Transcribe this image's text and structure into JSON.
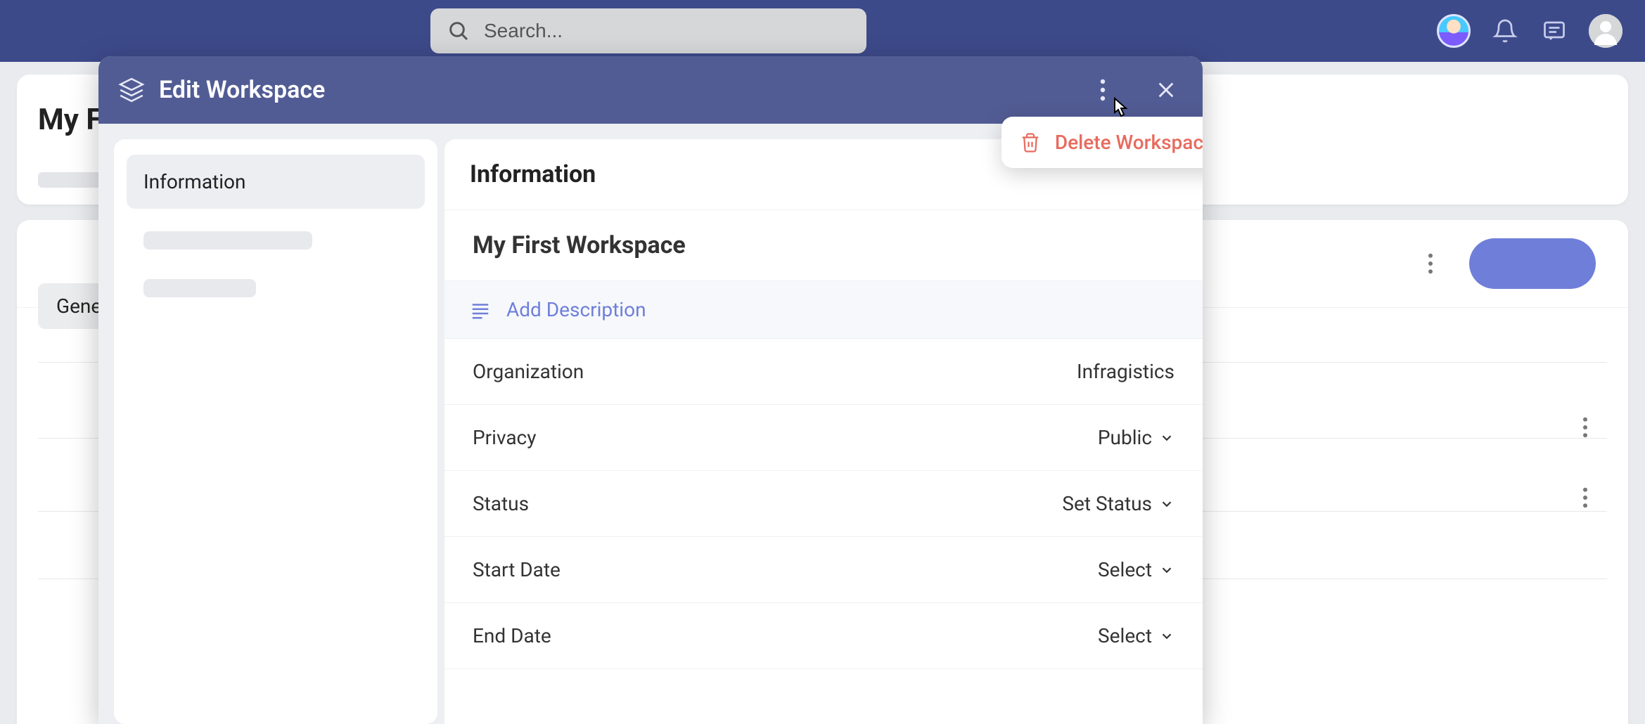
{
  "search": {
    "placeholder": "Search..."
  },
  "page": {
    "title_fragment": "My F",
    "tab_label_fragment": "Gene"
  },
  "modal": {
    "title": "Edit Workspace",
    "sidebar": {
      "items": [
        {
          "label": "Information"
        }
      ]
    },
    "section_heading": "Information",
    "workspace_name": "My First Workspace",
    "add_description_label": "Add Description",
    "fields": {
      "organization": {
        "label": "Organization",
        "value": "Infragistics"
      },
      "privacy": {
        "label": "Privacy",
        "value": "Public"
      },
      "status": {
        "label": "Status",
        "value": "Set Status"
      },
      "start_date": {
        "label": "Start Date",
        "value": "Select"
      },
      "end_date": {
        "label": "End Date",
        "value": "Select"
      }
    },
    "menu": {
      "delete": "Delete Workspace"
    }
  }
}
